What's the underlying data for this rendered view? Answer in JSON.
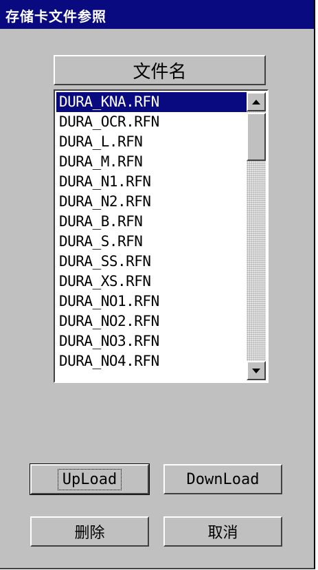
{
  "window": {
    "title": "存储卡文件参照"
  },
  "list": {
    "header": "文件名",
    "items": [
      "DURA_KNA.RFN",
      "DURA_OCR.RFN",
      "DURA_L.RFN",
      "DURA_M.RFN",
      "DURA_N1.RFN",
      "DURA_N2.RFN",
      "DURA_B.RFN",
      "DURA_S.RFN",
      "DURA_SS.RFN",
      "DURA_XS.RFN",
      "DURA_NO1.RFN",
      "DURA_NO2.RFN",
      "DURA_NO3.RFN",
      "DURA_NO4.RFN"
    ],
    "selected_item": "DURA_KNA.RFN"
  },
  "buttons": {
    "upload": "UpLoad",
    "download": "DownLoad",
    "delete": "删除",
    "cancel": "取消"
  },
  "colors": {
    "titlebar": "#0a0a80",
    "selection": "#0a0a80",
    "face": "#c0c0c0"
  }
}
